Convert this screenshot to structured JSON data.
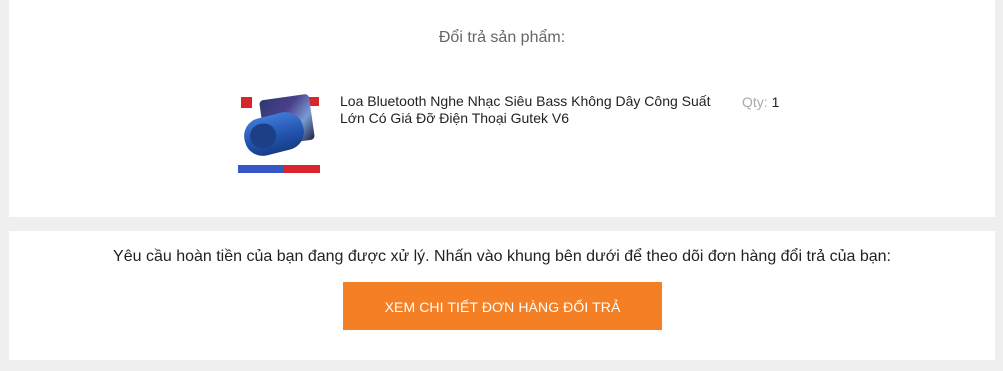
{
  "return_section": {
    "title": "Đổi trả sản phẩm:",
    "product": {
      "name": "Loa Bluetooth Nghe Nhạc Siêu Bass Không Dây Công Suất Lớn Có Giá Đỡ Điện Thoại Gutek V6",
      "qty_label": "Qty:",
      "qty_value": "1",
      "thumbnail_icon": "product-image"
    }
  },
  "refund_section": {
    "notice": "Yêu cầu hoàn tiền của bạn đang được xử lý. Nhấn vào khung bên dưới để theo dõi đơn hàng đổi trả của bạn:",
    "button_label": "XEM CHI TIẾT ĐƠN HÀNG ĐỔI TRẢ",
    "button_color": "#f47f24"
  },
  "colors": {
    "background": "#efefef",
    "card": "#ffffff",
    "accent": "#f47f24"
  }
}
